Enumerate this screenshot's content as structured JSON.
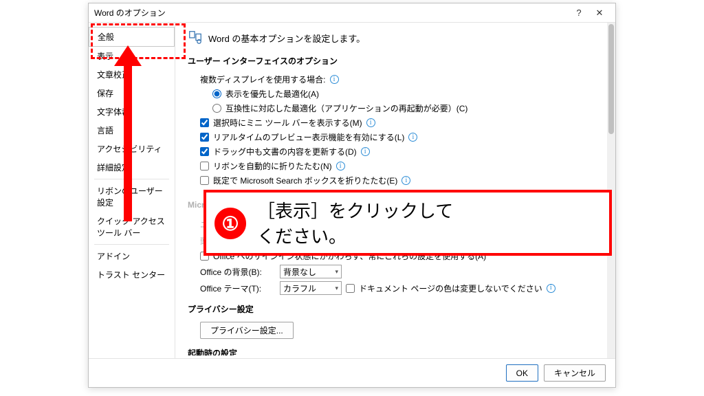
{
  "dialog": {
    "title": "Word のオプション",
    "help_icon": "?",
    "close_icon": "✕"
  },
  "sidebar": {
    "items": [
      "全般",
      "表示",
      "文章校正",
      "保存",
      "文字体裁",
      "言語",
      "アクセシビリティ",
      "詳細設定"
    ],
    "items2": [
      "リボンのユーザー設定",
      "クイック アクセス ツール バー"
    ],
    "items3": [
      "アドイン",
      "トラスト センター"
    ]
  },
  "content": {
    "heading": "Word の基本オプションを設定します。",
    "ui_section": "ユーザー インターフェイスのオプション",
    "multi_display": "複数ディスプレイを使用する場合:",
    "radio_opt_a": "表示を優先した最適化(A)",
    "radio_opt_c": "互換性に対応した最適化（アプリケーションの再起動が必要）(C)",
    "cb_mini_toolbar": "選択時にミニ ツール バーを表示する(M)",
    "cb_live_preview": "リアルタイムのプレビュー表示機能を有効にする(L)",
    "cb_drag_update": "ドラッグ中も文書の内容を更新する(D)",
    "cb_ribbon_collapse": "リボンを自動的に折りたたむ(N)",
    "cb_ms_search": "既定で Microsoft Search ボックスを折りたたむ(E)",
    "office_user_section": "Microsoft Office のユーザー設定",
    "user_name_label": "ユーザー名(U):",
    "user_name_value": "",
    "initials_label": "頭文字(I):",
    "cb_signin": "Office へのサインイン状態にかかわらず、常にこれらの設定を使用する(A)",
    "office_bg_label": "Office の背景(B):",
    "office_bg_value": "背景なし",
    "office_theme_label": "Office テーマ(T):",
    "office_theme_value": "カラフル",
    "cb_theme_noask": "ドキュメント ページの色は変更しないでください",
    "privacy_section": "プライバシー設定",
    "privacy_btn": "プライバシー設定...",
    "startup_section": "起動時の設定"
  },
  "buttons": {
    "ok": "OK",
    "cancel": "キャンセル"
  },
  "callout": {
    "num": "①",
    "line1": "［表示］をクリックして",
    "line2": "ください。"
  }
}
